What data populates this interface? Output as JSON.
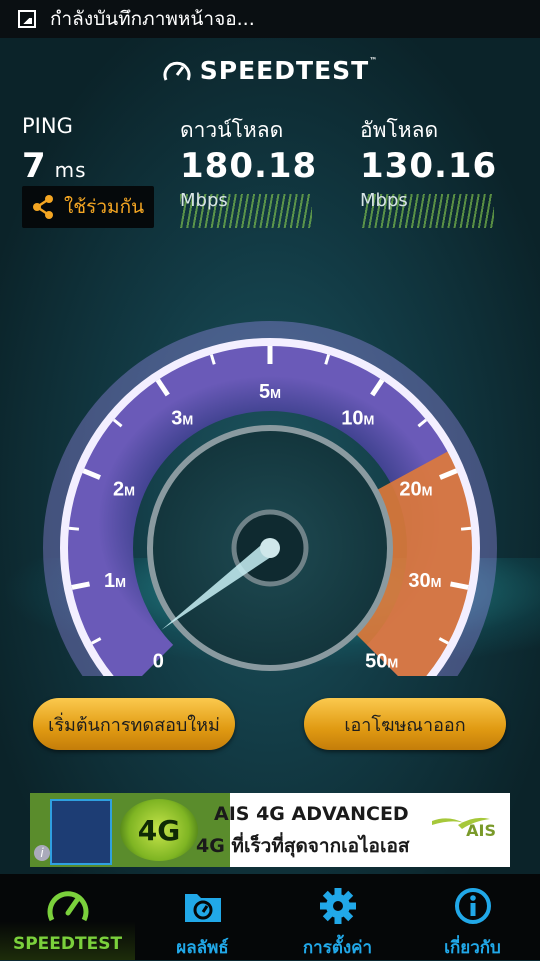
{
  "status_bar": {
    "text": "กำลังบันทึกภาพหน้าจอ..."
  },
  "app": {
    "logo_text": "SPEEDTEST",
    "logo_tm": "™"
  },
  "ping": {
    "label": "PING",
    "value": "7",
    "unit": "ms"
  },
  "download": {
    "label": "ดาวน์โหลด",
    "value": "180.18",
    "unit": "Mbps"
  },
  "upload": {
    "label": "อัพโหลด",
    "value": "130.16",
    "unit": "Mbps"
  },
  "share": {
    "label": "ใช้ร่วมกัน",
    "icon": "share-icon"
  },
  "gauge": {
    "ticks": [
      {
        "num": "0",
        "suffix": ""
      },
      {
        "num": "1",
        "suffix": "M"
      },
      {
        "num": "2",
        "suffix": "M"
      },
      {
        "num": "3",
        "suffix": "M"
      },
      {
        "num": "5",
        "suffix": "M"
      },
      {
        "num": "10",
        "suffix": "M"
      },
      {
        "num": "20",
        "suffix": "M"
      },
      {
        "num": "30",
        "suffix": "M"
      },
      {
        "num": "50",
        "suffix": "M"
      }
    ],
    "needle_value_mbps": 0
  },
  "buttons": {
    "restart": "เริ่มต้นการทดสอบใหม่",
    "remove_ads": "เอาโฆษณาออก"
  },
  "ad": {
    "badge_text": "4G",
    "title": "AIS 4G ADVANCED",
    "subtitle": "4G ที่เร็วที่สุดจากเอไอเอส",
    "brand": "AIS",
    "info": "i"
  },
  "tabs": [
    {
      "label": "SPEEDTEST",
      "icon": "speedometer-icon",
      "active": true
    },
    {
      "label": "ผลลัพธ์",
      "icon": "results-folder-icon",
      "active": false
    },
    {
      "label": "การตั้งค่า",
      "icon": "gear-icon",
      "active": false
    },
    {
      "label": "เกี่ยวกับ",
      "icon": "info-icon",
      "active": false
    }
  ],
  "colors": {
    "accent_blue": "#21a8e8",
    "accent_green": "#7bd13c",
    "button_gold": "#f4b231",
    "share_orange": "#f4a623"
  }
}
